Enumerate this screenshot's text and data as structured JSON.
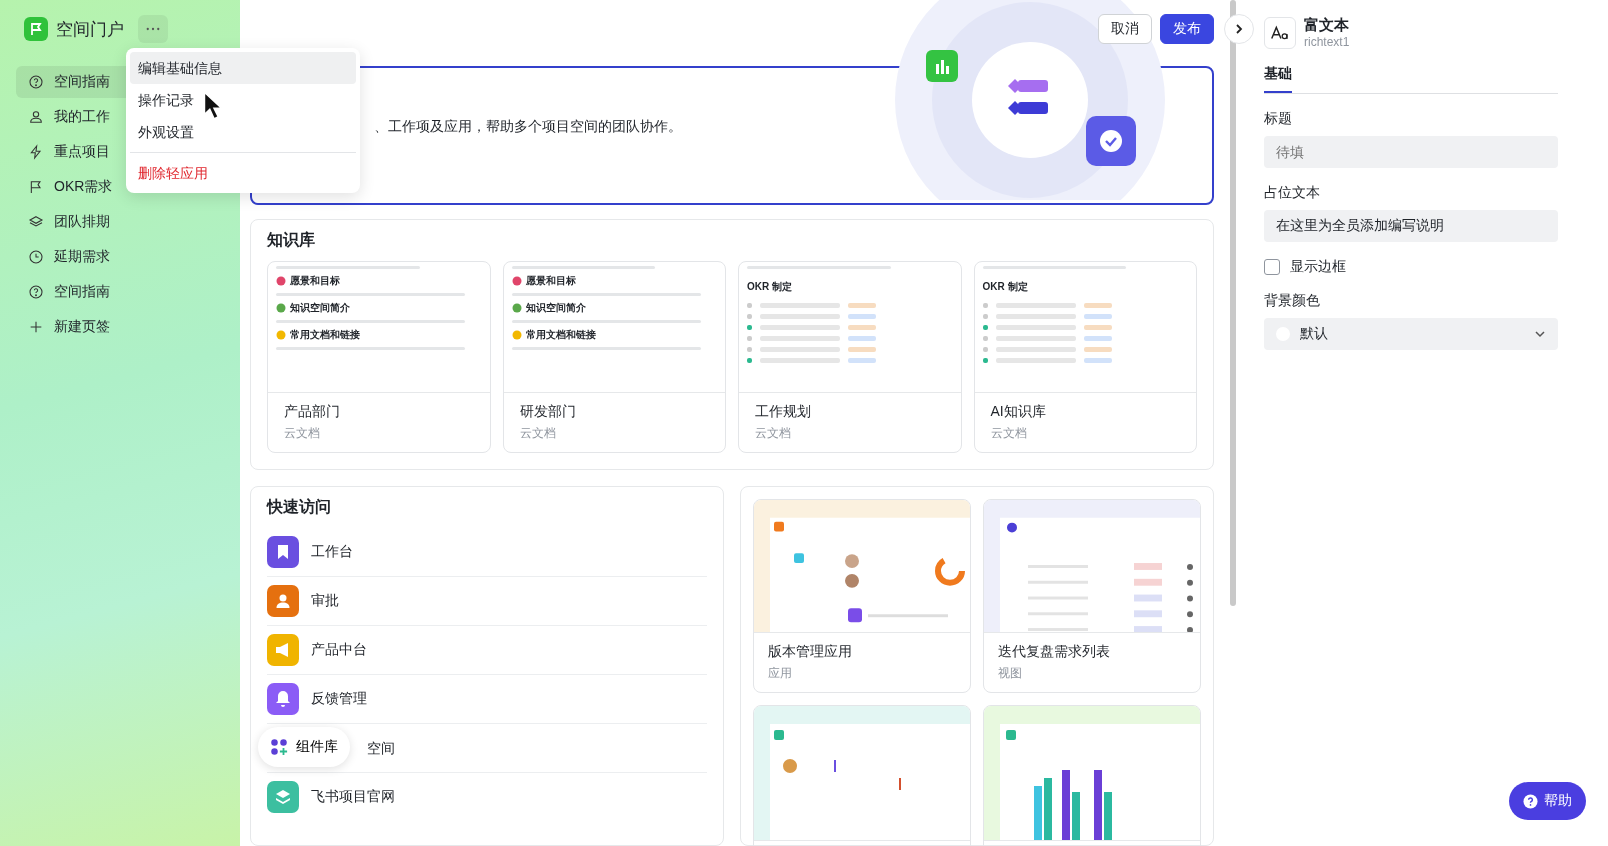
{
  "sidebar": {
    "title": "空间门户",
    "items": [
      {
        "label": "空间指南",
        "selected": true
      },
      {
        "label": "我的工作",
        "selected": false
      },
      {
        "label": "重点项目",
        "selected": false
      },
      {
        "label": "OKR需求",
        "selected": false
      },
      {
        "label": "团队排期",
        "selected": false
      },
      {
        "label": "延期需求",
        "selected": false
      },
      {
        "label": "空间指南",
        "selected": false
      },
      {
        "label": "新建页签",
        "selected": false
      }
    ]
  },
  "menu": {
    "items": [
      {
        "label": "编辑基础信息",
        "kind": "normal",
        "selected": true
      },
      {
        "label": "操作记录",
        "kind": "normal",
        "selected": false
      },
      {
        "label": "外观设置",
        "kind": "normal",
        "selected": false
      },
      {
        "label": "删除轻应用",
        "kind": "danger",
        "selected": false
      }
    ]
  },
  "header": {
    "buttons": [
      {
        "label": "取消",
        "kind": "secondary"
      },
      {
        "label": "发布",
        "kind": "primary"
      }
    ]
  },
  "hero": {
    "text": "、工作项及应用，帮助多个项目空间的团队协作。"
  },
  "knowledge": {
    "title": "知识库",
    "cards": [
      {
        "title": "产品部门",
        "subtitle": "云文档",
        "kind": "doc",
        "headings": [
          "愿景和目标",
          "知识空间简介",
          "常用文档和链接"
        ]
      },
      {
        "title": "研发部门",
        "subtitle": "云文档",
        "kind": "doc",
        "headings": [
          "愿景和目标",
          "知识空间简介",
          "常用文档和链接"
        ]
      },
      {
        "title": "工作规划",
        "subtitle": "云文档",
        "kind": "okr",
        "headings": [
          "OKR 制定"
        ]
      },
      {
        "title": "AI知识库",
        "subtitle": "云文档",
        "kind": "okr",
        "headings": [
          "OKR 制定"
        ]
      }
    ]
  },
  "quick": {
    "title": "快速访问",
    "items": [
      {
        "label": "工作台",
        "kind": "app",
        "color": "#6a4fe0"
      },
      {
        "label": "审批",
        "kind": "app",
        "color": "#e5700f"
      },
      {
        "label": "产品中台",
        "kind": "app",
        "color": "#f0b400"
      },
      {
        "label": "反馈管理",
        "kind": "app",
        "color": "#8b5cf6"
      },
      {
        "label": "空间",
        "kind": "covered"
      },
      {
        "label": "飞书项目官网",
        "kind": "app",
        "color": "#3cbfa0"
      }
    ]
  },
  "apps": [
    {
      "title": "版本管理应用",
      "subtitle": "应用",
      "kind": "dashboard"
    },
    {
      "title": "迭代复盘需求列表",
      "subtitle": "视图",
      "kind": "list"
    },
    {
      "kind": "timeline"
    },
    {
      "kind": "bars"
    }
  ],
  "widget_button": {
    "label": "组件库"
  },
  "help_button": {
    "label": "帮助"
  },
  "panel": {
    "title": "富文本",
    "id": "richtext1",
    "tabs": [
      {
        "label": "基础",
        "selected": true
      }
    ],
    "title_field": {
      "label": "标题",
      "placeholder": "待填"
    },
    "placeholder_field": {
      "label": "占位文本",
      "value": "在这里为全员添加编写说明"
    },
    "border_checkbox": {
      "label": "显示边框",
      "checked": false
    },
    "bg_color": {
      "label": "背景颜色",
      "value": "默认"
    }
  }
}
